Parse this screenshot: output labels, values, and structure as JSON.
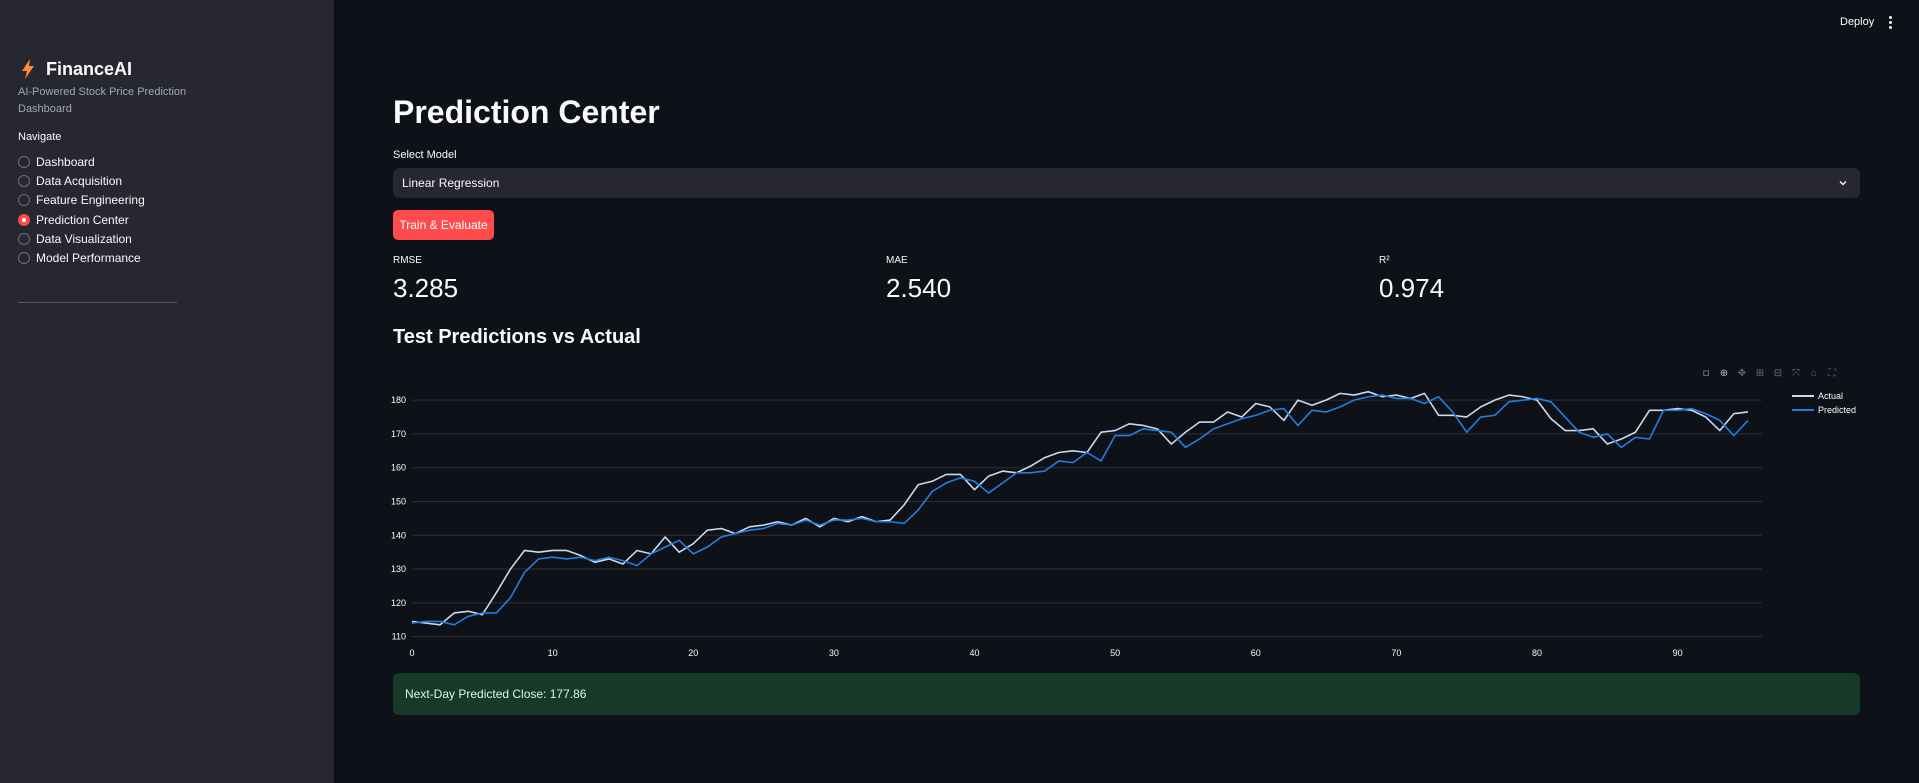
{
  "sidebar": {
    "app_name": "FinanceAI",
    "app_icon": "lightning-icon",
    "subtitle": "AI-Powered Stock Price Prediction Dashboard",
    "nav_heading": "Navigate",
    "items": [
      {
        "label": "Dashboard",
        "selected": false
      },
      {
        "label": "Data Acquisition",
        "selected": false
      },
      {
        "label": "Feature Engineering",
        "selected": false
      },
      {
        "label": "Prediction Center",
        "selected": true
      },
      {
        "label": "Data Visualization",
        "selected": false
      },
      {
        "label": "Model Performance",
        "selected": false
      }
    ]
  },
  "header": {
    "deploy_label": "Deploy",
    "menu_icon": "kebab-menu-icon"
  },
  "main": {
    "title": "Prediction Center",
    "select_label": "Select Model",
    "select_value": "Linear Regression",
    "train_button": "Train & Evaluate",
    "metrics": [
      {
        "label": "RMSE",
        "value": "3.285"
      },
      {
        "label": "MAE",
        "value": "2.540"
      },
      {
        "label": "R²",
        "value": "0.974"
      }
    ],
    "chart_title": "Test Predictions vs Actual",
    "alert_text": "Next-Day Predicted Close: 177.86"
  },
  "colors": {
    "accent": "#ff4b4b",
    "actual_line": "#c6dbf2",
    "predicted_line": "#1f7fe0",
    "success_bg": "#173928"
  },
  "chart_data": {
    "type": "line",
    "title": "Test Predictions vs Actual",
    "xlabel": "",
    "ylabel": "",
    "xlim": [
      0,
      96
    ],
    "ylim": [
      109,
      183
    ],
    "x_ticks": [
      0,
      10,
      20,
      30,
      40,
      50,
      60,
      70,
      80,
      90
    ],
    "y_ticks": [
      110,
      120,
      130,
      140,
      150,
      160,
      170,
      180
    ],
    "grid": true,
    "legend": "top-right",
    "series": [
      {
        "name": "Actual",
        "values": [
          114.5,
          114,
          113.5,
          117,
          117.5,
          116.5,
          123,
          130,
          135.5,
          135,
          135.5,
          135.5,
          134,
          132,
          133,
          131.5,
          135.5,
          134.5,
          139.5,
          135,
          137.5,
          141.5,
          142,
          140.5,
          142.5,
          143,
          144,
          143,
          145,
          142.5,
          145,
          144,
          145.5,
          144,
          144.5,
          149,
          155,
          156,
          158,
          158,
          153.5,
          157.5,
          159,
          158.5,
          160.5,
          163,
          164.5,
          165,
          164.5,
          170.5,
          171,
          173,
          172.5,
          171.5,
          167,
          170.5,
          173.5,
          173.5,
          176.5,
          175,
          179,
          178,
          174,
          180,
          178.5,
          180,
          182,
          181.5,
          182.5,
          181,
          181.5,
          180.5,
          182,
          175.5,
          175.5,
          175,
          178,
          180,
          181.5,
          181,
          180,
          174.5,
          171,
          171,
          171.5,
          167,
          168.5,
          170.5,
          177,
          177,
          177.5,
          177,
          175,
          171,
          176,
          176.5
        ]
      },
      {
        "name": "Predicted",
        "values": [
          114,
          114.5,
          114.5,
          113.5,
          116,
          117,
          117,
          121.5,
          129,
          133,
          133.5,
          133,
          133.5,
          132.5,
          133.5,
          132.5,
          131,
          134.5,
          136.5,
          138.5,
          134.5,
          136.5,
          139.5,
          140.5,
          141.5,
          142,
          143.5,
          143,
          144.5,
          143,
          144.5,
          144.5,
          145,
          144,
          144,
          143.5,
          147.5,
          153,
          155.5,
          157,
          156,
          152.5,
          155.5,
          158.5,
          158.5,
          159,
          162,
          161.5,
          164.5,
          162,
          169.5,
          169.5,
          171.5,
          171,
          170.5,
          166,
          168.5,
          171.5,
          173,
          174.5,
          175.5,
          177,
          177.5,
          172.5,
          177,
          176.5,
          178,
          180,
          181,
          181.5,
          180.5,
          180.5,
          179,
          181,
          176.5,
          170.5,
          175,
          175.5,
          179.5,
          180,
          180.5,
          179.5,
          175,
          170.5,
          169,
          170,
          166,
          169,
          168.5,
          177,
          177,
          177.5,
          176,
          174,
          169.5,
          174
        ]
      }
    ]
  }
}
